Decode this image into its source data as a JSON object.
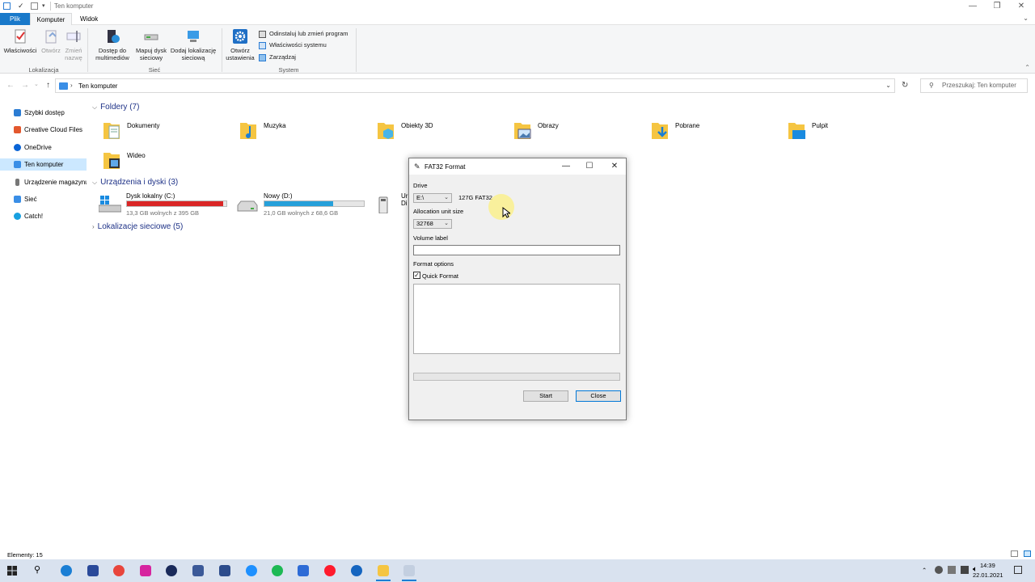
{
  "window": {
    "title": "Ten komputer",
    "minimize": "—",
    "maximize": "❐",
    "close": "✕"
  },
  "menu": {
    "file": "Plik",
    "computer": "Komputer",
    "view": "Widok"
  },
  "ribbon": {
    "properties": "Właściwości",
    "open": "Otwórz",
    "rename": "Zmień nazwę",
    "group_location": "Lokalizacja",
    "media_access": "Dostęp do multimediów",
    "map_drive": "Mapuj dysk sieciowy",
    "add_network_location": "Dodaj lokalizację sieciową",
    "group_network": "Sieć",
    "open_settings": "Otwórz ustawienia",
    "uninstall": "Odinstaluj lub zmień program",
    "system_properties": "Właściwości systemu",
    "manage": "Zarządzaj",
    "group_system": "System"
  },
  "address": {
    "path": "Ten komputer",
    "search_placeholder": "Przeszukaj: Ten komputer"
  },
  "nav": [
    {
      "label": "Szybki dostęp",
      "color": "#2b7cd3"
    },
    {
      "label": "Creative Cloud Files",
      "color": "#e3582e"
    },
    {
      "label": "OneDrive",
      "color": "#0a64d6"
    },
    {
      "label": "Ten komputer",
      "color": "#3a8ee6"
    },
    {
      "label": "Urządzenie magazynujące",
      "color": "#777777"
    },
    {
      "label": "Sieć",
      "color": "#3a8ee6"
    },
    {
      "label": "Catch!",
      "color": "#18a0e0"
    }
  ],
  "folders_section": "Foldery (7)",
  "folders": [
    "Dokumenty",
    "Muzyka",
    "Obiekty 3D",
    "Obrazy",
    "Pobrane",
    "Pulpit",
    "Wideo"
  ],
  "drives_section": "Urządzenia i dyski (3)",
  "drives": [
    {
      "name": "Dysk lokalny (C:)",
      "free": "13,3 GB wolnych z 395 GB",
      "used_fraction": 0.97,
      "color": "#da2626"
    },
    {
      "name": "Nowy (D:)",
      "free": "21,0 GB wolnych z 68,6 GB",
      "used_fraction": 0.69,
      "color": "#26a0da"
    },
    {
      "name": "Ur Di",
      "free": ""
    }
  ],
  "network_section": "Lokalizacje sieciowe (5)",
  "status": {
    "items": "Elementy: 15"
  },
  "clock": {
    "time": "14:39",
    "date": "22.01.2021"
  },
  "dialog": {
    "title": "FAT32 Format",
    "drive_label": "Drive",
    "drive_value": "E:\\",
    "drive_info": "127G FAT32",
    "alloc_label": "Allocation unit size",
    "alloc_value": "32768",
    "volume_label": "Volume label",
    "volume_value": "",
    "options_label": "Format options",
    "quick_format": "Quick Format",
    "quick_format_checked": true,
    "progress": 0,
    "start": "Start",
    "close": "Close"
  }
}
